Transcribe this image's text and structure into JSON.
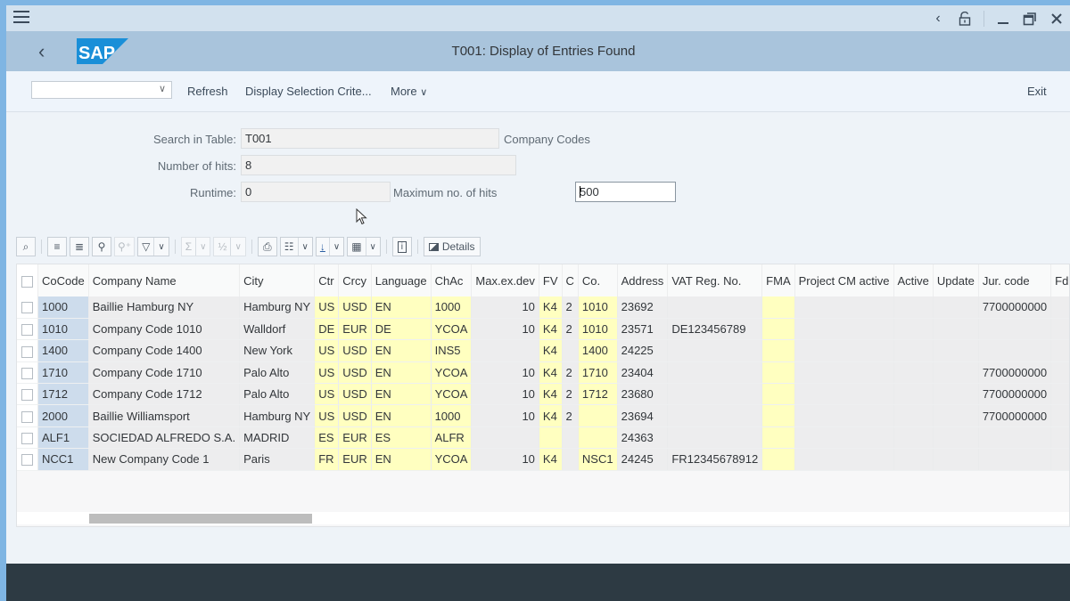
{
  "system_bar": {
    "icons": [
      "menu-icon",
      "back-icon",
      "unlock-icon",
      "minimize-icon",
      "restore-icon",
      "close-icon"
    ]
  },
  "title_bar": {
    "logo_text": "SAP",
    "title": "T001: Display of Entries Found",
    "colors": {
      "logo_blue": "#1a8fd8",
      "bar": "#a9c4dc"
    }
  },
  "toolbar": {
    "combo_value": "",
    "refresh": "Refresh",
    "display_selection": "Display Selection Crite...",
    "more": "More",
    "exit": "Exit"
  },
  "selection": {
    "search_label": "Search in Table:",
    "search_value": "T001",
    "search_desc": "Company Codes",
    "hits_label": "Number of hits:",
    "hits_value": "8",
    "runtime_label": "Runtime:",
    "runtime_value": "0",
    "max_label": "Maximum no. of hits",
    "max_value": "500"
  },
  "grid_toolbar": {
    "details": "Details"
  },
  "table": {
    "columns": [
      "CoCode",
      "Company Name",
      "City",
      "Ctr",
      "Crcy",
      "Language",
      "ChAc",
      "Max.ex.dev",
      "FV",
      "C",
      "Co.",
      "Address",
      "VAT Reg. No.",
      "FMA",
      "Project CM active",
      "Active",
      "Update",
      "Jur. code",
      "Fd"
    ],
    "rows": [
      [
        "1000",
        "Baillie Hamburg NY",
        "Hamburg NY",
        "US",
        "USD",
        "EN",
        "1000",
        "10",
        "K4",
        "2",
        "1010",
        "23692",
        "",
        "",
        "",
        "",
        "",
        "7700000000",
        ""
      ],
      [
        "1010",
        "Company Code 1010",
        "Walldorf",
        "DE",
        "EUR",
        "DE",
        "YCOA",
        "10",
        "K4",
        "2",
        "1010",
        "23571",
        "DE123456789",
        "",
        "",
        "",
        "",
        "",
        ""
      ],
      [
        "1400",
        "Company Code 1400",
        "New York",
        "US",
        "USD",
        "EN",
        "INS5",
        "",
        "K4",
        "",
        "1400",
        "24225",
        "",
        "",
        "",
        "",
        "",
        "",
        ""
      ],
      [
        "1710",
        "Company Code 1710",
        "Palo Alto",
        "US",
        "USD",
        "EN",
        "YCOA",
        "10",
        "K4",
        "2",
        "1710",
        "23404",
        "",
        "",
        "",
        "",
        "",
        "7700000000",
        ""
      ],
      [
        "1712",
        "Company Code 1712",
        "Palo Alto",
        "US",
        "USD",
        "EN",
        "YCOA",
        "10",
        "K4",
        "2",
        "1712",
        "23680",
        "",
        "",
        "",
        "",
        "",
        "7700000000",
        ""
      ],
      [
        "2000",
        "Baillie Williamsport",
        "Hamburg NY",
        "US",
        "USD",
        "EN",
        "1000",
        "10",
        "K4",
        "2",
        "",
        "23694",
        "",
        "",
        "",
        "",
        "",
        "7700000000",
        ""
      ],
      [
        "ALF1",
        "SOCIEDAD ALFREDO S.A.",
        "MADRID",
        "ES",
        "EUR",
        "ES",
        "ALFR",
        "",
        "",
        "",
        "",
        "24363",
        "",
        "",
        "",
        "",
        "",
        "",
        ""
      ],
      [
        "NCC1",
        "New Company Code 1",
        "Paris",
        "FR",
        "EUR",
        "EN",
        "YCOA",
        "10",
        "K4",
        "",
        "NSC1",
        "24245",
        "FR12345678912",
        "",
        "",
        "",
        "",
        "",
        ""
      ]
    ],
    "highlight_colors": {
      "key": "#cddcec",
      "editable": "#ffffc0",
      "readonly": "#ededee"
    }
  }
}
